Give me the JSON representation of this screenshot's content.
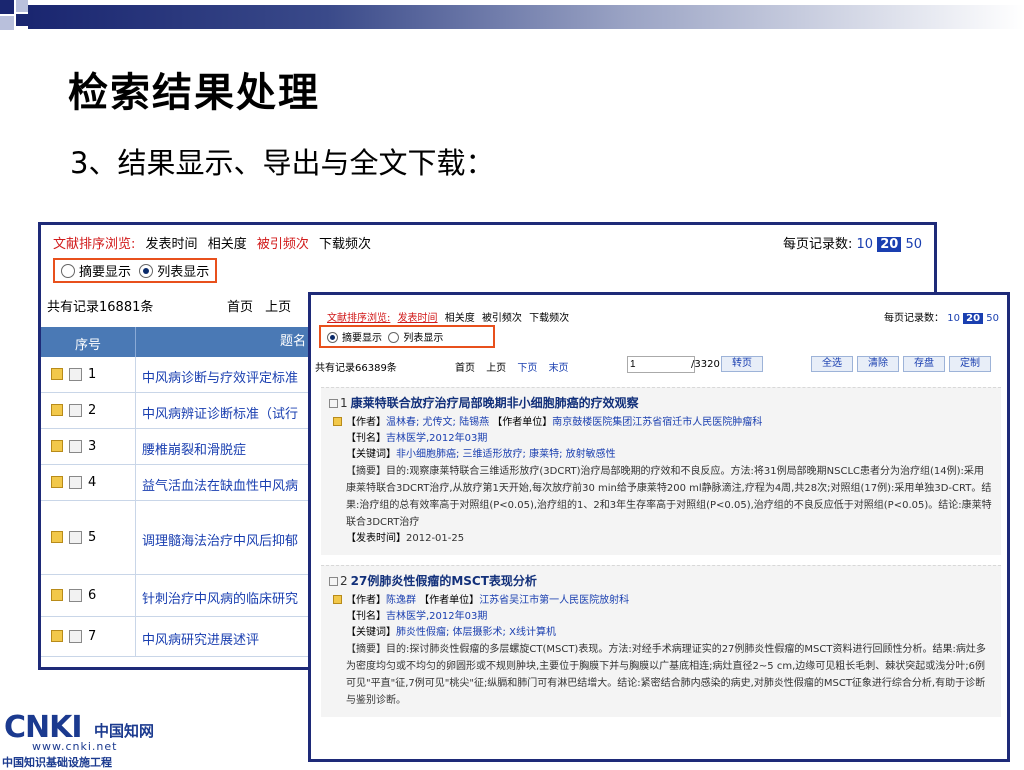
{
  "slide": {
    "title": "检索结果处理",
    "subtitle": "3、结果显示、导出与全文下载："
  },
  "colors": {
    "accent": "#1e2a78",
    "highlight": "#e8501c",
    "link": "#1a3fb0",
    "header": "#4a79b5"
  },
  "shot1": {
    "sort_label": "文献排序浏览:",
    "sort_options": [
      "发表时间",
      "相关度",
      "被引频次",
      "下载频次"
    ],
    "per_page_label": "每页记录数:",
    "per_page_options": [
      "10",
      "20",
      "50"
    ],
    "per_page_selected": "20",
    "mode_summary": "摘要显示",
    "mode_list": "列表显示",
    "total": "共有记录16881条",
    "nav": [
      "首页",
      "上页"
    ],
    "col_no": "序号",
    "col_title": "题名",
    "rows": [
      {
        "no": "1",
        "title": "中风病诊断与疗效评定标准"
      },
      {
        "no": "2",
        "title": "中风病辨证诊断标准（试行"
      },
      {
        "no": "3",
        "title": "腰椎崩裂和滑脱症"
      },
      {
        "no": "4",
        "title": "益气活血法在缺血性中风病"
      },
      {
        "no": "5",
        "title": "调理髓海法治疗中风后抑郁"
      },
      {
        "no": "6",
        "title": "针刺治疗中风病的临床研究"
      },
      {
        "no": "7",
        "title": "中风病研究进展述评"
      }
    ]
  },
  "shot2": {
    "sort_label": "文献排序浏览:",
    "sort_options": [
      "发表时间",
      "相关度",
      "被引频次",
      "下载频次"
    ],
    "per_page_label": "每页记录数：",
    "per_page_options": [
      "10",
      "20",
      "50"
    ],
    "per_page_selected": "20",
    "mode_summary": "摘要显示",
    "mode_list": "列表显示",
    "total": "共有记录66389条",
    "nav": [
      "首页",
      "上页",
      "下页",
      "末页"
    ],
    "page_value": "1",
    "page_count": "/3320",
    "goto": "转页",
    "buttons": {
      "select_all": "全选",
      "clear": "清除",
      "save": "存盘",
      "custom": "定制"
    },
    "results": [
      {
        "no": "1",
        "title": "康莱特联合放疗治疗局部晚期非小细胞肺癌的疗效观察",
        "author_label": "【作者】",
        "author": "温林春; 尤传文; 陆锡燕",
        "unit_label": "【作者单位】",
        "unit": "南京鼓楼医院集团江苏省宿迁市人民医院肿瘤科",
        "journal_label": "【刊名】",
        "journal": "吉林医学,2012年03期",
        "keywords_label": "【关键词】",
        "keywords": "非小细胞肺癌; 三维适形放疗; 康莱特; 放射敏感性",
        "abstract_label": "【摘要】",
        "abstract": "目的:观察康莱特联合三维适形放疗(3DCRT)治疗局部晚期的疗效和不良反应。方法:将31例局部晚期NSCLC患者分为治疗组(14例):采用康莱特联合3DCRT治疗,从放疗第1天开始,每次放疗前30 min给予康莱特200 ml静脉滴注,疗程为4周,共28次;对照组(17例):采用单独3D-CRT。结果:治疗组的总有效率高于对照组(P<0.05),治疗组的1、2和3年生存率高于对照组(P<0.05),治疗组的不良反应低于对照组(P<0.05)。结论:康莱特联合3DCRT治疗",
        "date_label": "【发表时间】",
        "date": "2012-01-25"
      },
      {
        "no": "2",
        "title": "27例肺炎性假瘤的MSCT表现分析",
        "author_label": "【作者】",
        "author": "陈逸群",
        "unit_label": "【作者单位】",
        "unit": "江苏省吴江市第一人民医院放射科",
        "journal_label": "【刊名】",
        "journal": "吉林医学,2012年03期",
        "keywords_label": "【关键词】",
        "keywords": "肺炎性假瘤; 体层摄影术; X线计算机",
        "abstract_label": "【摘要】",
        "abstract": "目的:探讨肺炎性假瘤的多层螺旋CT(MSCT)表现。方法:对经手术病理证实的27例肺炎性假瘤的MSCT资料进行回顾性分析。结果:病灶多为密度均匀或不均匀的卵圆形或不规则肿块,主要位于胸膜下并与胸膜以广基底相连;病灶直径2~5 cm,边缘可见粗长毛刺、棘状突起或浅分叶;6例可见\"平直\"征,7例可见\"桃尖\"征;纵膈和肺门可有淋巴结增大。结论:紧密结合肺内感染的病史,对肺炎性假瘤的MSCT征象进行综合分析,有助于诊断与鉴别诊断。"
      }
    ]
  },
  "logo": {
    "brand": "CNKI",
    "cn_name": "中国知网",
    "url": "www.cnki.net",
    "org": "中国知识基础设施工程"
  }
}
